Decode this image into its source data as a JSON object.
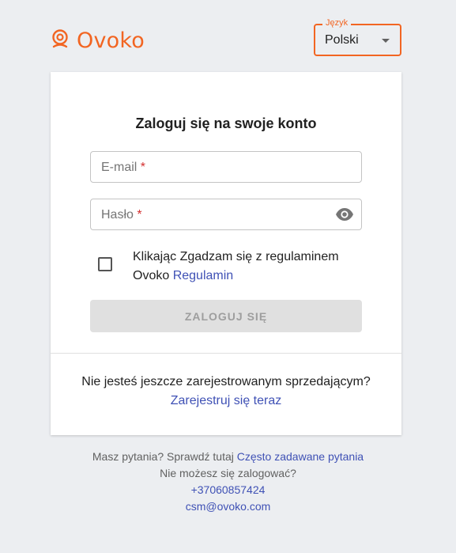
{
  "header": {
    "logo_text": "Ovoko",
    "brand_color": "#f26522",
    "language": {
      "label": "Język",
      "value": "Polski"
    }
  },
  "login": {
    "title": "Zaloguj się na swoje konto",
    "email_placeholder": "E-mail",
    "password_placeholder": "Hasło",
    "required_mark": "*",
    "terms_text": "Klikając Zgadzam się z regulaminem Ovoko",
    "terms_link": "Regulamin",
    "submit_label": "ZALOGUJ SIĘ",
    "register_text": "Nie jesteś jeszcze zarejestrowanym sprzedającym?",
    "register_link": "Zarejestruj się teraz"
  },
  "footer": {
    "questions_text": "Masz pytania? Sprawdź tutaj",
    "faq_link": "Często zadawane pytania",
    "cant_login": "Nie możesz się zalogować?",
    "phone": "+37060857424",
    "email": "csm@ovoko.com"
  },
  "icons": [
    "ovoko-logo-icon",
    "chevron-down-icon",
    "eye-icon"
  ]
}
